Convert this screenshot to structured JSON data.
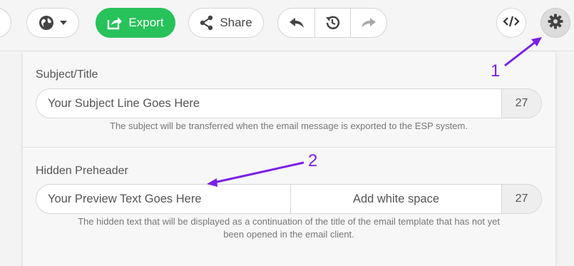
{
  "toolbar": {
    "export_label": "Export",
    "share_label": "Share",
    "globe_icon": "globe-icon",
    "code_icon": "code-icon",
    "gear_icon": "gear-icon"
  },
  "subject": {
    "label": "Subject/Title",
    "value": "Your Subject Line Goes Here",
    "count": "27",
    "help": "The subject will be transferred when the email message is exported to the ESP system."
  },
  "preheader": {
    "label": "Hidden Preheader",
    "value": "Your Preview Text Goes Here",
    "add_ws_label": "Add white space",
    "count": "27",
    "help_line1": "The hidden text that will be displayed as a continuation of the title of the email template that has not yet",
    "help_line2": "been opened in the email client."
  },
  "annotations": {
    "one": "1",
    "two": "2",
    "color": "#7b1fe6"
  },
  "colors": {
    "export_green": "#27c25a"
  }
}
